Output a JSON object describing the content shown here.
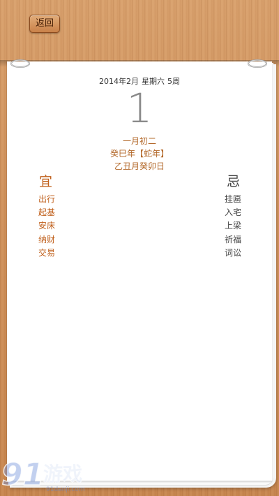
{
  "toolbar": {
    "back_label": "返回"
  },
  "calendar": {
    "date_line": {
      "date": "2014年2月",
      "weekday": "星期六",
      "week": "5周"
    },
    "day": "1",
    "lunar_date": "一月初二",
    "lunar_year": "癸巳年【蛇年】",
    "ganzhi": "乙丑月癸卯日"
  },
  "yi": {
    "title": "宜",
    "items": [
      "出行",
      "起基",
      "安床",
      "纳财",
      "交易"
    ]
  },
  "ji": {
    "title": "忌",
    "items": [
      "挂匾",
      "入宅",
      "上梁",
      "祈福",
      "词讼"
    ]
  },
  "watermark": {
    "text": "游戏",
    "site": "91danji.com",
    "logo_text": "91"
  },
  "colors": {
    "accent": "#c0601c",
    "wood": "#cf915b",
    "paper": "#ffffff"
  }
}
